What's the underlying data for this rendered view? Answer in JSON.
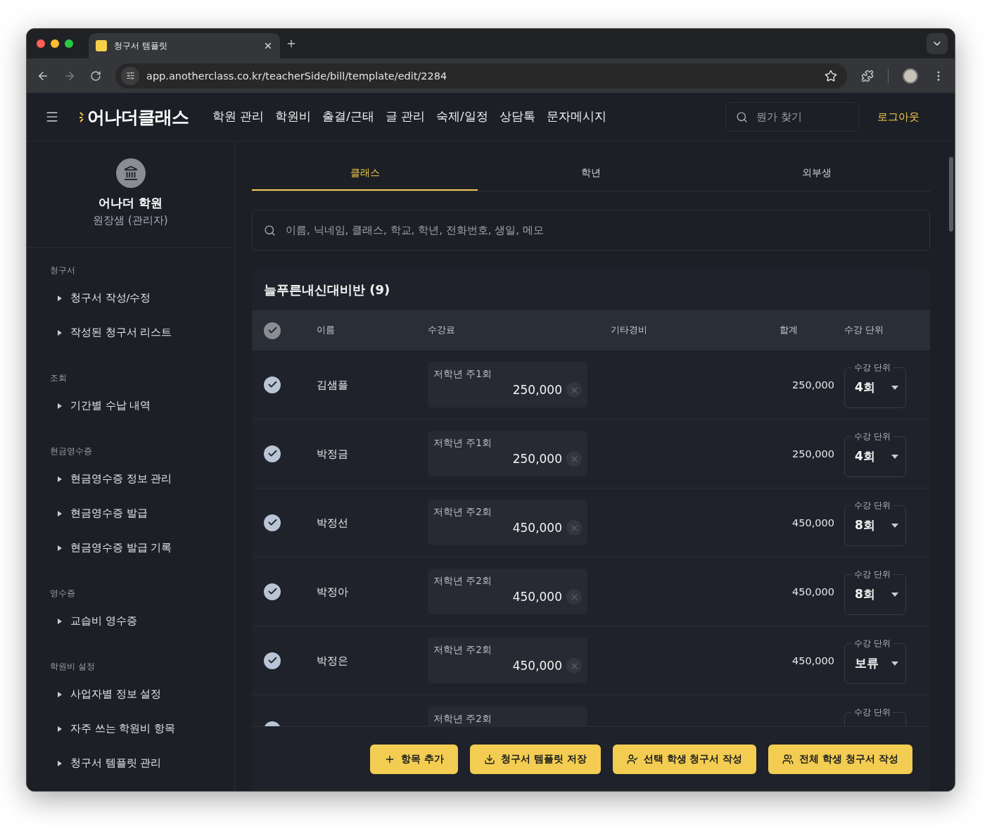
{
  "browser": {
    "tab_title": "청구서 템플릿",
    "url": "app.anotherclass.co.kr/teacherSide/bill/template/edit/2284"
  },
  "header": {
    "logo": "어나더클래스",
    "nav": [
      "학원 관리",
      "학원비",
      "출결/근태",
      "글 관리",
      "숙제/일정",
      "상담톡",
      "문자메시지"
    ],
    "search": {
      "placeholder": "뭔가 찾기"
    },
    "logout": "로그아웃"
  },
  "sidebar": {
    "academy": "어나더 학원",
    "role": "원장샘 (관리자)",
    "sections": [
      {
        "title": "청구서",
        "items": [
          "청구서 작성/수정",
          "작성된 청구서 리스트"
        ]
      },
      {
        "title": "조회",
        "items": [
          "기간별 수납 내역"
        ]
      },
      {
        "title": "현금영수증",
        "items": [
          "현금영수증 정보 관리",
          "현금영수증 발급",
          "현금영수증 발급 기록"
        ]
      },
      {
        "title": "영수증",
        "items": [
          "교습비 영수증"
        ]
      },
      {
        "title": "학원비 설정",
        "items": [
          "사업자별 정보 설정",
          "자주 쓰는 학원비 항목",
          "청구서 템플릿 관리"
        ]
      }
    ]
  },
  "tabs": [
    {
      "label": "클래스",
      "selected": true
    },
    {
      "label": "학년",
      "selected": false
    },
    {
      "label": "외부생",
      "selected": false
    }
  ],
  "student_search": {
    "placeholder": "이름, 닉네임, 클래스, 학교, 학년, 전화번호, 생일, 메모"
  },
  "class_table": {
    "title": "늘푸른내신대비반 (9)",
    "select_all": {
      "checked": true
    },
    "columns": [
      "이름",
      "수강료",
      "기타경비",
      "합계",
      "수강 단위"
    ],
    "rows": [
      {
        "checked": true,
        "name": "김샘플",
        "fee_label": "저학년 주1회",
        "fee": "250,000",
        "total": "250,000",
        "unit_label": "수강 단위",
        "unit": "4회"
      },
      {
        "checked": true,
        "name": "박정금",
        "fee_label": "저학년 주1회",
        "fee": "250,000",
        "total": "250,000",
        "unit_label": "수강 단위",
        "unit": "4회"
      },
      {
        "checked": true,
        "name": "박정선",
        "fee_label": "저학년 주2회",
        "fee": "450,000",
        "total": "450,000",
        "unit_label": "수강 단위",
        "unit": "8회"
      },
      {
        "checked": true,
        "name": "박정아",
        "fee_label": "저학년 주2회",
        "fee": "450,000",
        "total": "450,000",
        "unit_label": "수강 단위",
        "unit": "8회"
      },
      {
        "checked": true,
        "name": "박정은",
        "fee_label": "저학년 주2회",
        "fee": "450,000",
        "total": "450,000",
        "unit_label": "수강 단위",
        "unit": "보류"
      },
      {
        "checked": true,
        "fee_label": "저학년 주2회",
        "unit_label": "수강 단위"
      }
    ]
  },
  "actions": [
    {
      "kind": "add",
      "label": "항목 추가"
    },
    {
      "kind": "save",
      "label": "청구서 템플릿 저장"
    },
    {
      "kind": "selected",
      "label": "선택 학생 청구서 작성"
    },
    {
      "kind": "all",
      "label": "전체 학생 청구서 작성"
    }
  ]
}
